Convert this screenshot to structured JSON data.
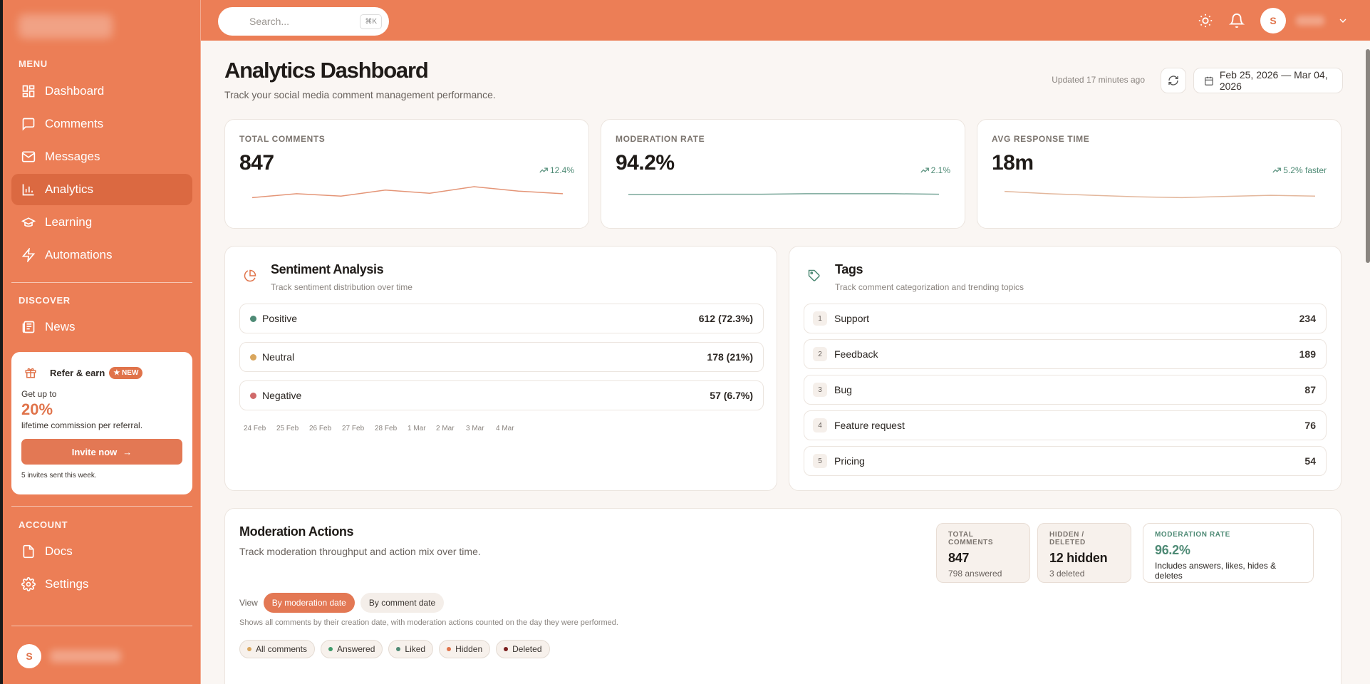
{
  "colors": {
    "accent": "#ec7e56",
    "positive": "#4e8a75",
    "neutral": "#d9a65d",
    "negative": "#d06a6a",
    "deleted": "#7a1f1f"
  },
  "sidebar": {
    "menu_label": "MENU",
    "menu_items": [
      {
        "label": "Dashboard",
        "icon": "grid-icon"
      },
      {
        "label": "Comments",
        "icon": "message-square-icon"
      },
      {
        "label": "Messages",
        "icon": "mail-icon"
      },
      {
        "label": "Analytics",
        "icon": "bar-chart-icon",
        "active": true
      },
      {
        "label": "Learning",
        "icon": "graduation-cap-icon"
      },
      {
        "label": "Automations",
        "icon": "lightning-icon"
      }
    ],
    "discover_label": "DISCOVER",
    "discover_items": [
      {
        "label": "News",
        "icon": "newspaper-icon"
      }
    ],
    "refer": {
      "title": "Refer & earn",
      "badge": "★ NEW",
      "sub": "Get up to",
      "percent": "20%",
      "desc": "lifetime commission per referral.",
      "button": "Invite now",
      "foot": "5 invites sent this week."
    },
    "account_label": "ACCOUNT",
    "account_items": [
      {
        "label": "Docs",
        "icon": "file-icon"
      },
      {
        "label": "Settings",
        "icon": "gear-icon"
      }
    ],
    "user_initial": "S"
  },
  "topbar": {
    "search_placeholder": "Search...",
    "search_shortcut": "⌘K",
    "user_initial": "S"
  },
  "header": {
    "title": "Analytics Dashboard",
    "subtitle": "Track your social media comment management performance.",
    "updated": "Updated 17 minutes ago",
    "date_range": "Feb 25, 2026 — Mar 04, 2026"
  },
  "kpis": [
    {
      "label": "TOTAL COMMENTS",
      "value": "847",
      "trend": "12.4%",
      "spark_color": "#e49577",
      "spark": [
        0.3,
        0.55,
        0.4,
        0.78,
        0.58,
        1.0,
        0.72,
        0.55
      ]
    },
    {
      "label": "MODERATION RATE",
      "value": "94.2%",
      "trend": "2.1%",
      "spark_color": "#7aa79a",
      "spark": [
        0.5,
        0.5,
        0.52,
        0.52,
        0.55,
        0.55,
        0.55,
        0.52
      ]
    },
    {
      "label": "AVG RESPONSE TIME",
      "value": "18m",
      "trend": "5.2% faster",
      "spark_color": "#e3b79c",
      "spark": [
        0.7,
        0.55,
        0.45,
        0.35,
        0.3,
        0.38,
        0.45,
        0.4
      ]
    }
  ],
  "sentiment": {
    "title": "Sentiment Analysis",
    "subtitle": "Track sentiment distribution over time",
    "rows": [
      {
        "label": "Positive",
        "value": "612 (72.3%)",
        "color": "#4e8a75"
      },
      {
        "label": "Neutral",
        "value": "178 (21%)",
        "color": "#d9a65d"
      },
      {
        "label": "Negative",
        "value": "57 (6.7%)",
        "color": "#d06a6a"
      }
    ],
    "x_labels": [
      "24 Feb",
      "25 Feb",
      "26 Feb",
      "27 Feb",
      "28 Feb",
      "1 Mar",
      "2 Mar",
      "3 Mar",
      "4 Mar"
    ]
  },
  "tags": {
    "title": "Tags",
    "subtitle": "Track comment categorization and trending topics",
    "rows": [
      {
        "rank": "1",
        "label": "Support",
        "value": "234"
      },
      {
        "rank": "2",
        "label": "Feedback",
        "value": "189"
      },
      {
        "rank": "3",
        "label": "Bug",
        "value": "87"
      },
      {
        "rank": "4",
        "label": "Feature request",
        "value": "76"
      },
      {
        "rank": "5",
        "label": "Pricing",
        "value": "54"
      }
    ]
  },
  "moderation": {
    "title": "Moderation Actions",
    "subtitle": "Track moderation throughput and action mix over time.",
    "stats": [
      {
        "label": "TOTAL COMMENTS",
        "value": "847",
        "note": "798 answered"
      },
      {
        "label": "HIDDEN / DELETED",
        "value": "12 hidden",
        "note": "3 deleted"
      },
      {
        "label": "MODERATION RATE",
        "value": "96.2%",
        "note": "Includes answers, likes, hides & deletes"
      }
    ],
    "view_label": "View",
    "view_options": [
      "By moderation date",
      "By comment date"
    ],
    "hint": "Shows all comments by their creation date, with moderation actions counted on the day they were performed.",
    "filters": [
      {
        "label": "All comments",
        "color": "#d9a65d"
      },
      {
        "label": "Answered",
        "color": "#3f9a6a"
      },
      {
        "label": "Liked",
        "color": "#4e8a75"
      },
      {
        "label": "Hidden",
        "color": "#e0734a"
      },
      {
        "label": "Deleted",
        "color": "#7a1f1f"
      }
    ]
  }
}
